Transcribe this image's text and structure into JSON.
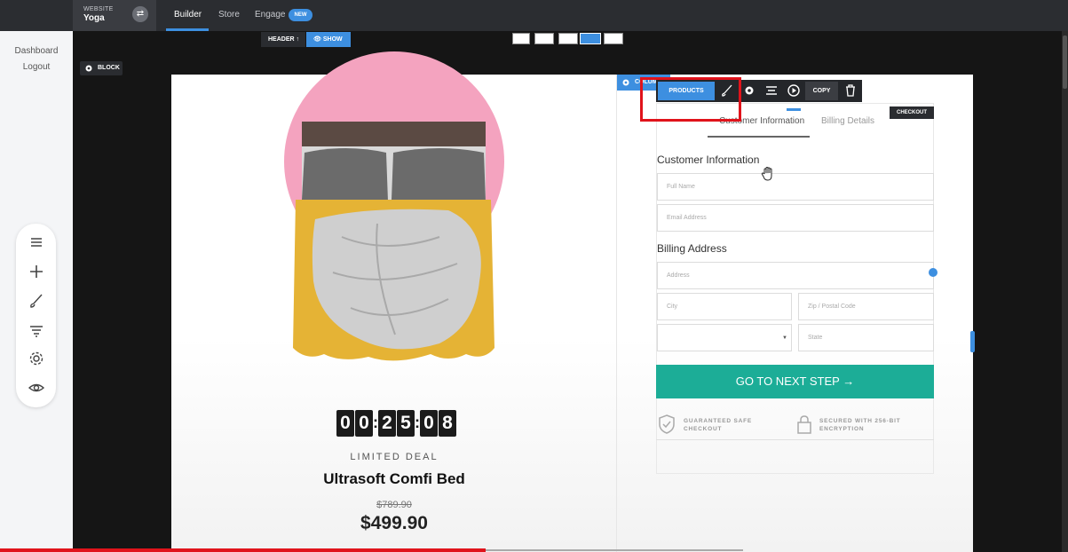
{
  "topbar": {
    "website_label": "WEBSITE",
    "website_name": "Yoga",
    "tabs": [
      "Builder",
      "Store",
      "Engage"
    ],
    "new_badge": "NEW"
  },
  "leftnav": {
    "links": [
      "Dashboard",
      "Logout"
    ]
  },
  "toolrail": {
    "icons": [
      "menu-icon",
      "plus-icon",
      "brush-icon",
      "filter-icon",
      "gear-icon",
      "eye-icon"
    ]
  },
  "canvas_toolbar": {
    "header_label": "HEADER ↑",
    "show_label": "SHOW",
    "block_label": "BLOCK"
  },
  "product": {
    "timer_digits": [
      "0",
      "0",
      "2",
      "5",
      "0",
      "8"
    ],
    "deal_label": "LIMITED DEAL",
    "title": "Ultrasoft Comfi Bed",
    "old_price": "$789.90",
    "new_price": "$499.90"
  },
  "column_toolbar": {
    "column_label": "COLUMN",
    "products_label": "PRODUCTS",
    "copy_label": "COPY",
    "checkout_tag": "CHECKOUT"
  },
  "checkout": {
    "tabs": [
      "Customer Information",
      "Billing Details"
    ],
    "customer_heading": "Customer Information",
    "billing_heading": "Billing Address",
    "placeholders": {
      "full_name": "Full Name",
      "email": "Email Address",
      "address": "Address",
      "city": "City",
      "zip": "Zip / Postal Code",
      "state": "State"
    },
    "next_button": "GO TO NEXT STEP →",
    "trust_safe": "GUARANTEED SAFE CHECKOUT",
    "trust_secure": "SECURED WITH 256-BIT ENCRYPTION"
  },
  "colors": {
    "accent": "#3d8fe0",
    "cta": "#1cad97",
    "highlight": "#e0131b",
    "pink": "#f4a3bf"
  }
}
